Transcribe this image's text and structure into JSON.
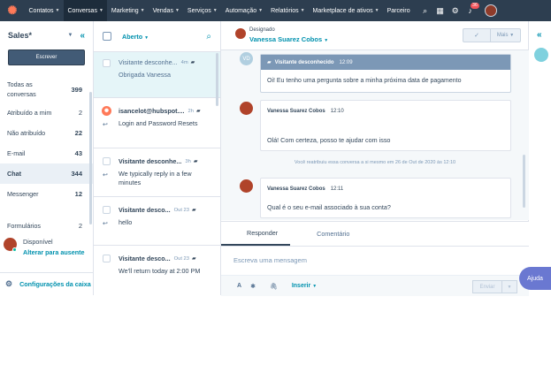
{
  "topnav": {
    "logo_icon": "hubspot-sprocket-icon",
    "items": [
      {
        "label": "Contatos"
      },
      {
        "label": "Conversas"
      },
      {
        "label": "Marketing"
      },
      {
        "label": "Vendas"
      },
      {
        "label": "Serviços"
      },
      {
        "label": "Automação"
      },
      {
        "label": "Relatórios"
      },
      {
        "label": "Marketplace de ativos"
      },
      {
        "label": "Parceiro"
      }
    ],
    "notifications_count": "36"
  },
  "sidebar": {
    "title": "Sales*",
    "compose_label": "Escrever",
    "items": [
      {
        "label": "Todas as conversas",
        "count": "399"
      },
      {
        "label": "Atribuído a mim",
        "count": "2"
      },
      {
        "label": "Não atribuído",
        "count": "22"
      },
      {
        "label": "E-mail",
        "count": "43"
      },
      {
        "label": "Chat",
        "count": "344"
      },
      {
        "label": "Messenger",
        "count": "12"
      },
      {
        "label": "Formulários",
        "count": "2"
      }
    ],
    "user_status": "Disponível",
    "user_action": "Alterar para ausente",
    "settings_label": "Configurações da caixa de entrada"
  },
  "inbox": {
    "filter_label": "Aberto",
    "conversations": [
      {
        "name": "Visitante desconhe...",
        "time": "4m",
        "snippet": "Obrigada Vanessa"
      },
      {
        "name": "isancelot@hubspot....",
        "time": "2h",
        "snippet": "Login and Password Resets"
      },
      {
        "name": "Visitante desconhe...",
        "time": "3h",
        "snippet": "We typically reply in a few minutes"
      },
      {
        "name": "Visitante desco...",
        "time": "Out 23",
        "snippet": "hello"
      },
      {
        "name": "Visitante desco...",
        "time": "Out 23",
        "snippet": "We'll return today at 2:00 PM"
      }
    ]
  },
  "conversation": {
    "assigned_label": "Designado",
    "assignee": "Vanessa Suarez Cobos",
    "check_button": "✓",
    "more_label": "Mais",
    "visitor_initials": "VD",
    "messages": [
      {
        "sender": "Visitante desconhecido",
        "time": "12:09",
        "text": "Oi! Eu tenho uma pergunta sobre a minha próxima data de pagamento"
      },
      {
        "sender": "Vanessa Suarez Cobos",
        "time": "12:10",
        "text": "Olá! Com certeza, posso te ajudar com isso"
      },
      {
        "sender": "Vanessa Suarez Cobos",
        "time": "12:11",
        "text": "Qual é o seu e-mail associado à sua conta?"
      }
    ],
    "system_note": "Você reatribuiu essa conversa a si mesmo em 26 de Out de 2020 às 12:10"
  },
  "composer": {
    "tab_reply": "Responder",
    "tab_comment": "Comentário",
    "placeholder": "Escreva uma mensagem",
    "insert_label": "Inserir",
    "send_label": "Enviar"
  },
  "help_label": "Ajuda"
}
